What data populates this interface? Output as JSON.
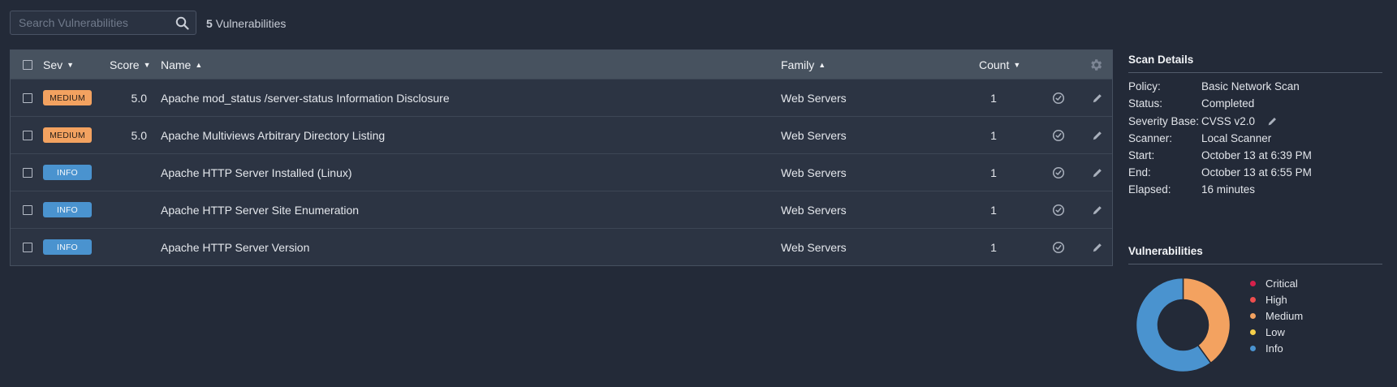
{
  "search": {
    "placeholder": "Search Vulnerabilities"
  },
  "summary": {
    "count": "5",
    "label": "Vulnerabilities"
  },
  "table": {
    "headers": {
      "sev": "Sev",
      "score": "Score",
      "name": "Name",
      "family": "Family",
      "count": "Count"
    },
    "sort_indicators": {
      "sev": "▼",
      "score": "▼",
      "name": "▲",
      "family": "▲",
      "count": "▼"
    },
    "rows": [
      {
        "severity": "MEDIUM",
        "score": "5.0",
        "name": "Apache mod_status /server-status Information Disclosure",
        "family": "Web Servers",
        "count": "1"
      },
      {
        "severity": "MEDIUM",
        "score": "5.0",
        "name": "Apache Multiviews Arbitrary Directory Listing",
        "family": "Web Servers",
        "count": "1"
      },
      {
        "severity": "INFO",
        "score": "",
        "name": "Apache HTTP Server Installed (Linux)",
        "family": "Web Servers",
        "count": "1"
      },
      {
        "severity": "INFO",
        "score": "",
        "name": "Apache HTTP Server Site Enumeration",
        "family": "Web Servers",
        "count": "1"
      },
      {
        "severity": "INFO",
        "score": "",
        "name": "Apache HTTP Server Version",
        "family": "Web Servers",
        "count": "1"
      }
    ]
  },
  "scan_details": {
    "title": "Scan Details",
    "policy_label": "Policy:",
    "policy": "Basic Network Scan",
    "status_label": "Status:",
    "status": "Completed",
    "severity_base_label": "Severity Base:",
    "severity_base": "CVSS v2.0",
    "scanner_label": "Scanner:",
    "scanner": "Local Scanner",
    "start_label": "Start:",
    "start": "October 13 at 6:39 PM",
    "end_label": "End:",
    "end": "October 13 at 6:55 PM",
    "elapsed_label": "Elapsed:",
    "elapsed": "16 minutes"
  },
  "vulnerabilities_panel": {
    "title": "Vulnerabilities",
    "legend": [
      {
        "label": "Critical",
        "color": "#d6204b"
      },
      {
        "label": "High",
        "color": "#ee4e4e"
      },
      {
        "label": "Medium",
        "color": "#f3a260"
      },
      {
        "label": "Low",
        "color": "#f5cf4a"
      },
      {
        "label": "Info",
        "color": "#4a93cf"
      }
    ]
  },
  "chart_data": {
    "type": "pie",
    "variant": "donut",
    "categories": [
      "Critical",
      "High",
      "Medium",
      "Low",
      "Info"
    ],
    "values": [
      0,
      0,
      2,
      0,
      3
    ],
    "colors": [
      "#d6204b",
      "#ee4e4e",
      "#f3a260",
      "#f5cf4a",
      "#4a93cf"
    ],
    "legend_position": "right"
  },
  "icons": {
    "search": "search-icon",
    "settings": "gear-icon",
    "resolved": "check-circle-icon",
    "edit": "pencil-icon"
  }
}
